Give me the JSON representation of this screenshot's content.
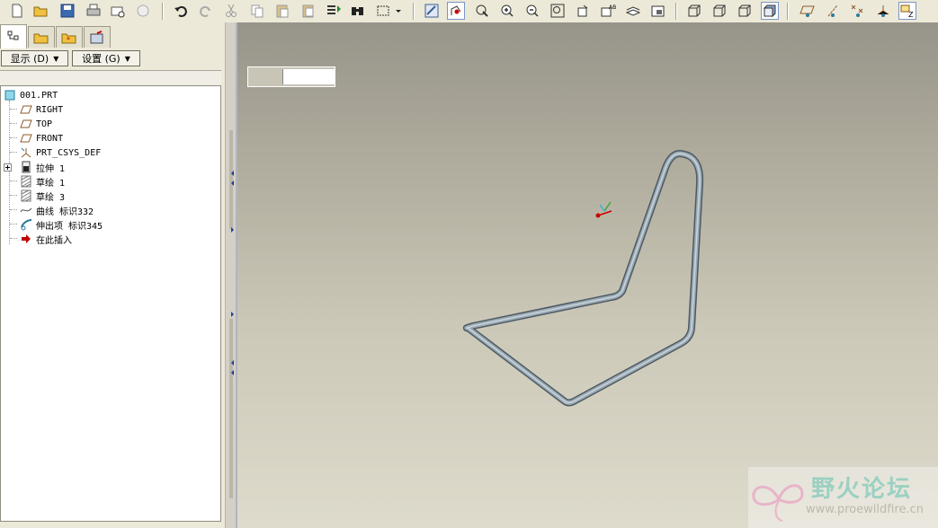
{
  "toolbar": {
    "icons": [
      "new-icon",
      "open-icon",
      "save-icon",
      "print-icon",
      "email-icon",
      "send-icon",
      "undo-icon",
      "redo-icon",
      "cut-icon",
      "copy-icon",
      "paste-icon",
      "paste-special-icon",
      "regenerate-icon",
      "find-icon",
      "select-box-icon",
      "dropdown-icon",
      "repaint-icon",
      "spin-center-icon",
      "orient-icon",
      "zoom-in-icon",
      "zoom-out-icon",
      "fit-icon",
      "reorient-icon",
      "saved-views-icon",
      "layers-icon",
      "view-manager-icon",
      "wireframe-icon",
      "hidden-line-icon",
      "no-hidden-icon",
      "shading-icon",
      "datum-planes-icon",
      "datum-axes-icon",
      "datum-points-icon",
      "csys-icon",
      "annotations-icon"
    ]
  },
  "tabs": [
    "model-tree-tab",
    "folder-tab",
    "favorites-tab",
    "connections-tab"
  ],
  "left_buttons": {
    "show": "显示 (D)",
    "settings": "设置 (G)"
  },
  "tree": {
    "root": "001.PRT",
    "items": [
      {
        "label": "RIGHT",
        "icon": "datum-plane-icon"
      },
      {
        "label": "TOP",
        "icon": "datum-plane-icon"
      },
      {
        "label": "FRONT",
        "icon": "datum-plane-icon"
      },
      {
        "label": "PRT_CSYS_DEF",
        "icon": "csys-icon"
      },
      {
        "label": "拉伸 1",
        "icon": "extrude-icon"
      },
      {
        "label": "草绘 1",
        "icon": "sketch-icon"
      },
      {
        "label": "草绘 3",
        "icon": "sketch-icon"
      },
      {
        "label": "曲线 标识332",
        "icon": "curve-icon"
      },
      {
        "label": "伸出项 标识345",
        "icon": "sweep-icon"
      },
      {
        "label": "在此插入",
        "icon": "insert-here-icon"
      }
    ]
  },
  "watermark": {
    "title": "野火论坛",
    "url": "www.proewildfire.cn"
  },
  "colors": {
    "accent": "#7a96c2",
    "tube": "#7d8a93",
    "datum_plane": "#8b5a2b",
    "insert_arrow": "#c00000"
  }
}
